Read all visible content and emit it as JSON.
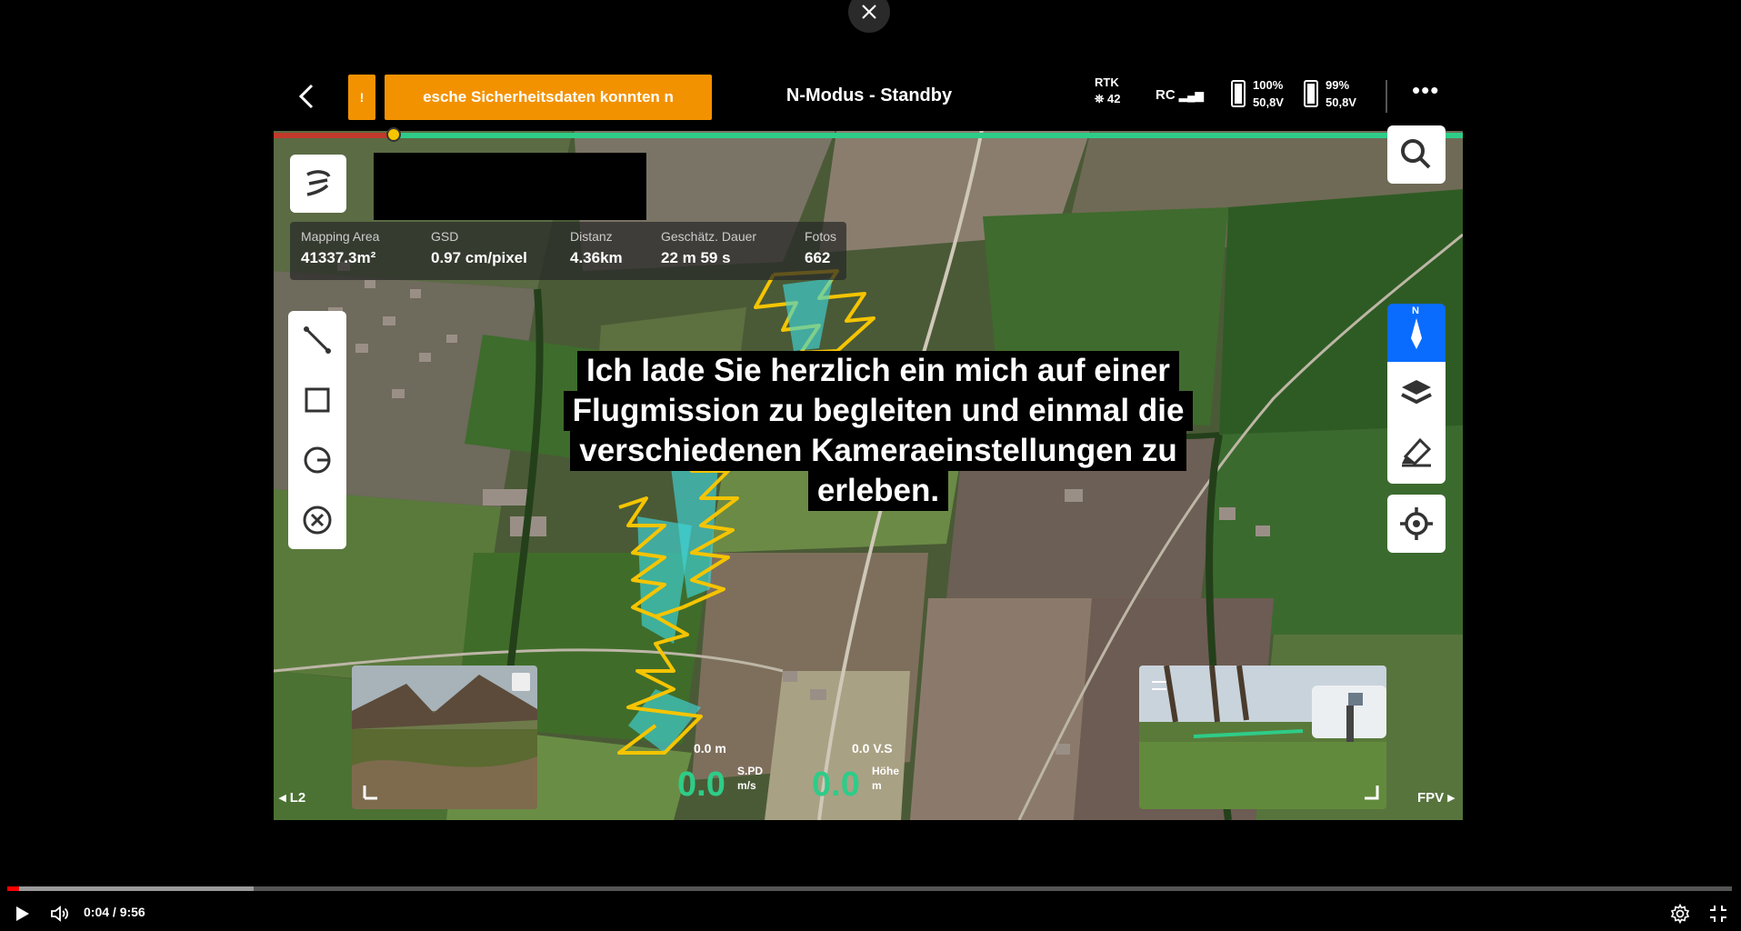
{
  "app": {
    "warning_icon": "!",
    "warning_text": "esche Sicherheitsdaten konnten n",
    "mode_title": "N-Modus - Standby",
    "rtk_label": "RTK",
    "rtk_value": "42",
    "rc_label": "RC",
    "battery1": {
      "percent": "100%",
      "voltage": "50,8V",
      "level": 1.0
    },
    "battery2": {
      "percent": "99%",
      "voltage": "50,8V",
      "level": 0.99
    }
  },
  "stats": [
    {
      "label": "Mapping Area",
      "value": "41337.3m²"
    },
    {
      "label": "GSD",
      "value": "0.97 cm/pixel"
    },
    {
      "label": "Distanz",
      "value": "4.36km"
    },
    {
      "label": "Geschätz. Dauer",
      "value": "22 m 59 s"
    },
    {
      "label": "Fotos",
      "value": "662"
    }
  ],
  "subtitle": {
    "lines": [
      "Ich lade Sie herzlich ein mich auf einer",
      "Flugmission zu begleiten und einmal die",
      "verschiedenen Kameraeinstellungen zu",
      "erleben."
    ]
  },
  "telemetry": {
    "hs_label": "0.0 m",
    "hs_value": "0.0",
    "hs_unit_top": "S.PD",
    "hs_unit_bottom": "m/s",
    "vs_label": "0.0 V.S",
    "vs_value": "0.0",
    "vs_unit_top": "Höhe",
    "vs_unit_bottom": "m"
  },
  "labels": {
    "l2": "L2",
    "fpv": "FPV",
    "compass_n": "N"
  },
  "player": {
    "time": "0:04 / 9:56",
    "played_fraction": 0.007,
    "buffered_fraction": 0.143
  },
  "colors": {
    "accent_orange": "#f39200",
    "telemetry_green": "#2ecc88",
    "compass_blue": "#0a6cff",
    "flight_path_yellow": "#f5c400",
    "coverage_cyan": "#3fd6d8"
  }
}
